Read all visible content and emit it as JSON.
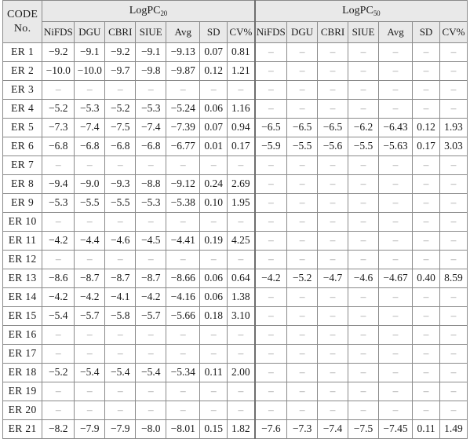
{
  "table": {
    "code_header": {
      "line1": "CODE",
      "line2": "No."
    },
    "groups": [
      {
        "label_main": "LogPC",
        "label_sub": "20"
      },
      {
        "label_main": "LogPC",
        "label_sub": "50"
      }
    ],
    "sub_headers": [
      "NiFDS",
      "DGU",
      "CBRI",
      "SIUE",
      "Avg",
      "SD",
      "CV%"
    ],
    "empty_marker": "–",
    "rows": [
      {
        "code": "ER  1",
        "pc20": [
          "−9.2",
          "−9.1",
          "−9.2",
          "−9.1",
          "−9.13",
          "0.07",
          "0.81"
        ],
        "pc50": [
          "–",
          "–",
          "–",
          "–",
          "–",
          "–",
          "–"
        ]
      },
      {
        "code": "ER  2",
        "pc20": [
          "−10.0",
          "−10.0",
          "−9.7",
          "−9.8",
          "−9.87",
          "0.12",
          "1.21"
        ],
        "pc50": [
          "–",
          "–",
          "–",
          "–",
          "–",
          "–",
          "–"
        ]
      },
      {
        "code": "ER  3",
        "pc20": [
          "–",
          "–",
          "–",
          "–",
          "–",
          "–",
          "–"
        ],
        "pc50": [
          "–",
          "–",
          "–",
          "–",
          "–",
          "–",
          "–"
        ]
      },
      {
        "code": "ER  4",
        "pc20": [
          "−5.2",
          "−5.3",
          "−5.2",
          "−5.3",
          "−5.24",
          "0.06",
          "1.16"
        ],
        "pc50": [
          "–",
          "–",
          "–",
          "–",
          "–",
          "–",
          "–"
        ]
      },
      {
        "code": "ER  5",
        "pc20": [
          "−7.3",
          "−7.4",
          "−7.5",
          "−7.4",
          "−7.39",
          "0.07",
          "0.94"
        ],
        "pc50": [
          "−6.5",
          "−6.5",
          "−6.5",
          "−6.2",
          "−6.43",
          "0.12",
          "1.93"
        ]
      },
      {
        "code": "ER  6",
        "pc20": [
          "−6.8",
          "−6.8",
          "−6.8",
          "−6.8",
          "−6.77",
          "0.01",
          "0.17"
        ],
        "pc50": [
          "−5.9",
          "−5.5",
          "−5.6",
          "−5.5",
          "−5.63",
          "0.17",
          "3.03"
        ]
      },
      {
        "code": "ER  7",
        "pc20": [
          "–",
          "–",
          "–",
          "–",
          "–",
          "–",
          "–"
        ],
        "pc50": [
          "–",
          "–",
          "–",
          "–",
          "–",
          "–",
          "–"
        ]
      },
      {
        "code": "ER  8",
        "pc20": [
          "−9.4",
          "−9.0",
          "−9.3",
          "−8.8",
          "−9.12",
          "0.24",
          "2.69"
        ],
        "pc50": [
          "–",
          "–",
          "–",
          "–",
          "–",
          "–",
          "–"
        ]
      },
      {
        "code": "ER  9",
        "pc20": [
          "−5.3",
          "−5.5",
          "−5.5",
          "−5.3",
          "−5.38",
          "0.10",
          "1.95"
        ],
        "pc50": [
          "–",
          "–",
          "–",
          "–",
          "–",
          "–",
          "–"
        ]
      },
      {
        "code": "ER  10",
        "pc20": [
          "–",
          "–",
          "–",
          "–",
          "–",
          "–",
          "–"
        ],
        "pc50": [
          "–",
          "–",
          "–",
          "–",
          "–",
          "–",
          "–"
        ]
      },
      {
        "code": "ER  11",
        "pc20": [
          "−4.2",
          "−4.4",
          "−4.6",
          "−4.5",
          "−4.41",
          "0.19",
          "4.25"
        ],
        "pc50": [
          "–",
          "–",
          "–",
          "–",
          "–",
          "–",
          "–"
        ]
      },
      {
        "code": "ER  12",
        "pc20": [
          "–",
          "–",
          "–",
          "–",
          "–",
          "–",
          "–"
        ],
        "pc50": [
          "–",
          "–",
          "–",
          "–",
          "–",
          "–",
          "–"
        ]
      },
      {
        "code": "ER  13",
        "pc20": [
          "−8.6",
          "−8.7",
          "−8.7",
          "−8.7",
          "−8.66",
          "0.06",
          "0.64"
        ],
        "pc50": [
          "−4.2",
          "−5.2",
          "−4.7",
          "−4.6",
          "−4.67",
          "0.40",
          "8.59"
        ]
      },
      {
        "code": "ER  14",
        "pc20": [
          "−4.2",
          "−4.2",
          "−4.1",
          "−4.2",
          "−4.16",
          "0.06",
          "1.38"
        ],
        "pc50": [
          "–",
          "–",
          "–",
          "–",
          "–",
          "–",
          "–"
        ]
      },
      {
        "code": "ER  15",
        "pc20": [
          "−5.4",
          "−5.7",
          "−5.8",
          "−5.7",
          "−5.66",
          "0.18",
          "3.10"
        ],
        "pc50": [
          "–",
          "–",
          "–",
          "–",
          "–",
          "–",
          "–"
        ]
      },
      {
        "code": "ER  16",
        "pc20": [
          "–",
          "–",
          "–",
          "–",
          "–",
          "–",
          "–"
        ],
        "pc50": [
          "–",
          "–",
          "–",
          "–",
          "–",
          "–",
          "–"
        ]
      },
      {
        "code": "ER  17",
        "pc20": [
          "–",
          "–",
          "–",
          "–",
          "–",
          "–",
          "–"
        ],
        "pc50": [
          "–",
          "–",
          "–",
          "–",
          "–",
          "–",
          "–"
        ]
      },
      {
        "code": "ER  18",
        "pc20": [
          "−5.2",
          "−5.4",
          "−5.4",
          "−5.4",
          "−5.34",
          "0.11",
          "2.00"
        ],
        "pc50": [
          "–",
          "–",
          "–",
          "–",
          "–",
          "–",
          "–"
        ]
      },
      {
        "code": "ER  19",
        "pc20": [
          "–",
          "–",
          "–",
          "–",
          "–",
          "–",
          "–"
        ],
        "pc50": [
          "–",
          "–",
          "–",
          "–",
          "–",
          "–",
          "–"
        ]
      },
      {
        "code": "ER  20",
        "pc20": [
          "–",
          "–",
          "–",
          "–",
          "–",
          "–",
          "–"
        ],
        "pc50": [
          "–",
          "–",
          "–",
          "–",
          "–",
          "–",
          "–"
        ]
      },
      {
        "code": "ER  21",
        "pc20": [
          "−8.2",
          "−7.9",
          "−7.9",
          "−8.0",
          "−8.01",
          "0.15",
          "1.82"
        ],
        "pc50": [
          "−7.6",
          "−7.3",
          "−7.4",
          "−7.5",
          "−7.45",
          "0.11",
          "1.49"
        ]
      }
    ]
  },
  "colors": {
    "header_background": "#e9e9e9",
    "border": "#8a8a8a",
    "group_divider": "#6e6e6e",
    "text": "#1a1a1a",
    "empty_text": "#9a9a9a"
  }
}
